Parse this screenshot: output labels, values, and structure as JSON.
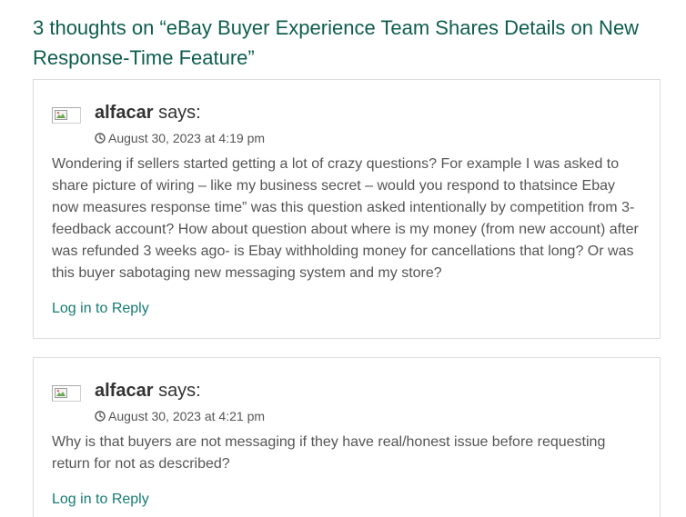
{
  "comments_title": "3 thoughts on “eBay Buyer Experience Team Shares Details on New Response-Time Feature”",
  "comments": [
    {
      "author": "alfacar",
      "says": "says:",
      "date": "August 30, 2023 at 4:19 pm",
      "body": "Wondering if sellers started getting a lot of crazy questions? For example I was asked to share picture of wiring – like my business secret – would you respond to thatsince Ebay now measures response time” was this question asked intentionally by competition from 3-feedback account? How about question about where is my money (from new account) after was refunded 3 weeks ago- is Ebay withholding money for cancellations that long? Or was this buyer sabotaging new messaging system and my store?",
      "reply_label": "Log in to Reply"
    },
    {
      "author": "alfacar",
      "says": "says:",
      "date": "August 30, 2023 at 4:21 pm",
      "body": "Why is that buyers are not messaging if they have real/honest issue before requesting return for not as described?",
      "reply_label": "Log in to Reply"
    }
  ],
  "icons": {
    "avatar": "broken-image-icon",
    "date": "clock-icon"
  },
  "colors": {
    "title": "#0e5e4f",
    "link": "#167b72",
    "text": "#555555",
    "author": "#333333",
    "border": "#dddddd"
  }
}
